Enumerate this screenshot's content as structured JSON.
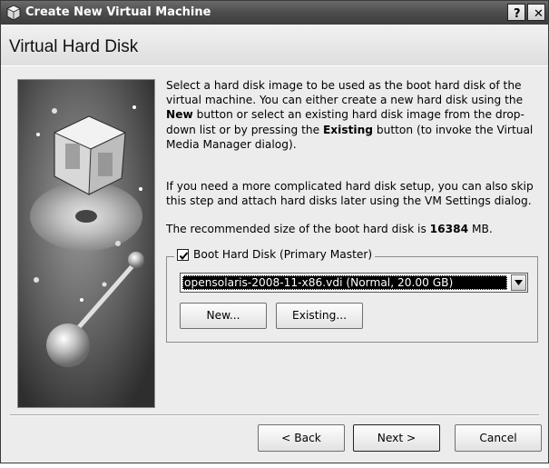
{
  "window": {
    "title": "Create New Virtual Machine",
    "help_button": "?",
    "close_button": "✕"
  },
  "header": {
    "title": "Virtual Hard Disk"
  },
  "description": {
    "p1_a": "Select a hard disk image to be used as the boot hard disk of the virtual machine. You can either create a new hard disk using the ",
    "p1_new": "New",
    "p1_b": " button or select an existing hard disk image from the drop-down list or by pressing the ",
    "p1_existing": "Existing",
    "p1_c": " button (to invoke the Virtual Media Manager dialog).",
    "p2": "If you need a more complicated hard disk setup, you can also skip this step and attach hard disks later using the VM Settings dialog.",
    "p3_a": "The recommended size of the boot hard disk is ",
    "p3_size": "16384",
    "p3_b": " MB."
  },
  "boot_disk": {
    "label": "Boot Hard Disk (Primary Master)",
    "checked": true,
    "selected": "opensolaris-2008-11-x86.vdi (Normal, 20.00 GB)",
    "new_label": "New...",
    "existing_label": "Existing..."
  },
  "footer": {
    "back_label": "< Back",
    "next_label": "Next >",
    "cancel_label": "Cancel"
  },
  "icons": {
    "app": "virtualbox-icon",
    "dropdown": "chevron-down-icon",
    "check": "checkmark-icon"
  }
}
